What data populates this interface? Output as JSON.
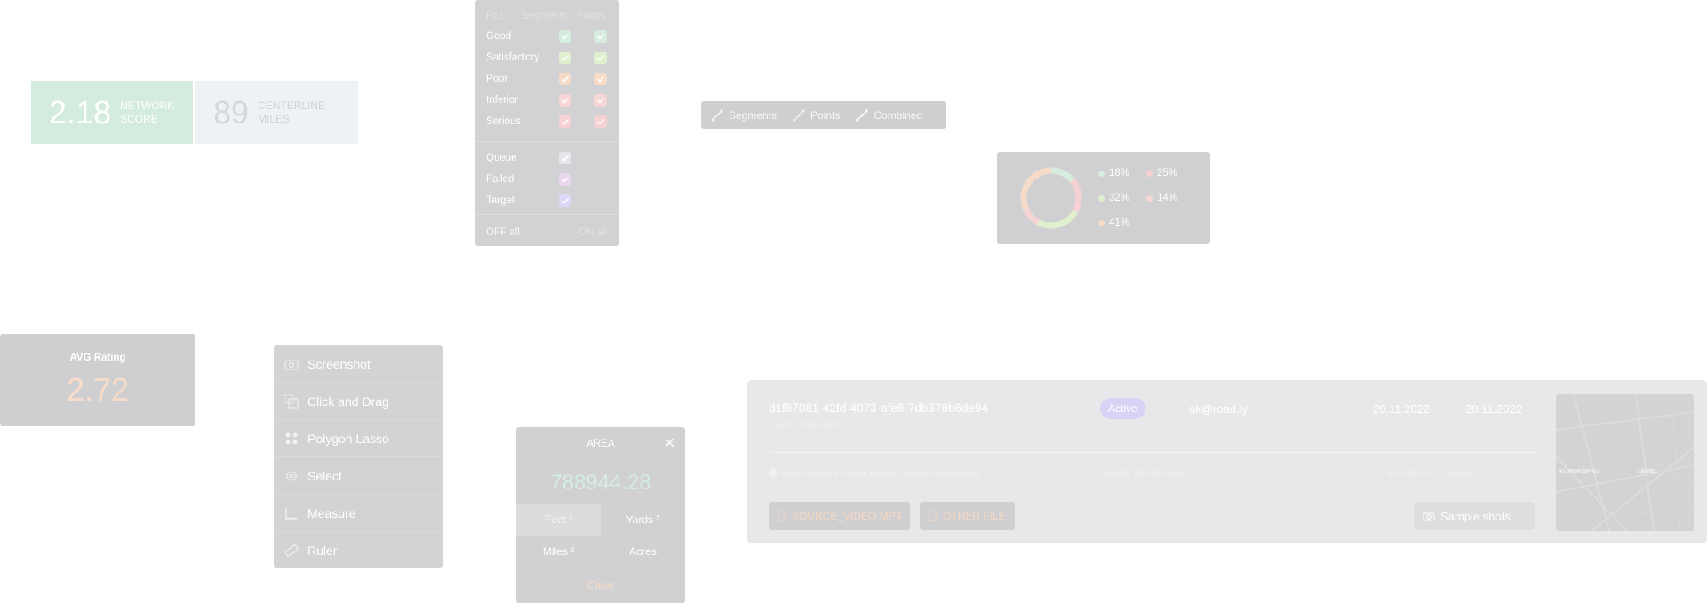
{
  "score_cards": {
    "network": {
      "value": "2.18",
      "label_line1": "NETWORK",
      "label_line2": "SCORE"
    },
    "miles": {
      "value": "89",
      "label_line1": "CENTERLINE",
      "label_line2": "MILES"
    }
  },
  "pci_panel": {
    "col_pci": "PCI",
    "col_segments": "Segments",
    "col_points": "Points",
    "rows": [
      {
        "name": "Good",
        "color": "#d6ecdf"
      },
      {
        "name": "Satisfactory",
        "color": "#dff0cf"
      },
      {
        "name": "Poor",
        "color": "#f6dcc8"
      },
      {
        "name": "Inferior",
        "color": "#f5d6d5"
      },
      {
        "name": "Serious",
        "color": "#f5d1d3"
      }
    ],
    "status_rows": [
      {
        "name": "Queue",
        "color": "#e6e7ea"
      },
      {
        "name": "Failed",
        "color": "#ead6ee"
      },
      {
        "name": "Target",
        "color": "#dcd7f5"
      }
    ],
    "off_all": "OFF all",
    "on_all": "ON all"
  },
  "seg_toolbar": {
    "segments": "Segments",
    "points": "Points",
    "combined": "Combined"
  },
  "donut": {
    "items": [
      {
        "label": "18%",
        "color": "#d6ecdf",
        "value": 18
      },
      {
        "label": "25%",
        "color": "#f5d1d3",
        "value": 25
      },
      {
        "label": "32%",
        "color": "#dff0cf",
        "value": 32
      },
      {
        "label": "14%",
        "color": "#f5d6d5",
        "value": 14
      },
      {
        "label": "41%",
        "color": "#f6dcc8",
        "value": 41
      }
    ]
  },
  "avg_rating": {
    "title": "AVG Rating",
    "value": "2.72"
  },
  "tools": [
    {
      "label": "Screenshot",
      "icon": "camera-icon"
    },
    {
      "label": "Click and Drag",
      "icon": "copy-icon"
    },
    {
      "label": "Polygon Lasso",
      "icon": "grid-icon"
    },
    {
      "label": "Select",
      "icon": "gear-icon"
    },
    {
      "label": "Measure",
      "icon": "measure-icon"
    },
    {
      "label": "Ruler",
      "icon": "ruler-icon"
    }
  ],
  "area_panel": {
    "title": "AREA",
    "value": "788944.28",
    "units": [
      "Feet ²",
      "Yards ²",
      "Miles ²",
      "Acres"
    ],
    "selected_unit": "Feet ²",
    "clear": "Clear"
  },
  "session": {
    "id": "d1f87081-42fd-4073-afe8-7db378b6de94",
    "id_sub": "Route / Inspection",
    "status": "Active",
    "email": "ak@road.ly",
    "date1": "20.11.2022",
    "date2": "20.11.2022",
    "address": "Gazi Mustafa Kemal Bulvarı, Mollа Yusuf Mahal",
    "length": "Length: 223.00 Feet",
    "time": "4:43 AM — 5:38 AM",
    "file1": "SOURCE_VIDEO.MP4",
    "file2": "OTHER FILE",
    "sample_shots": "Sample shots",
    "map_label1": "KURUKÖPRÜ",
    "map_label2": "LEVEL"
  }
}
